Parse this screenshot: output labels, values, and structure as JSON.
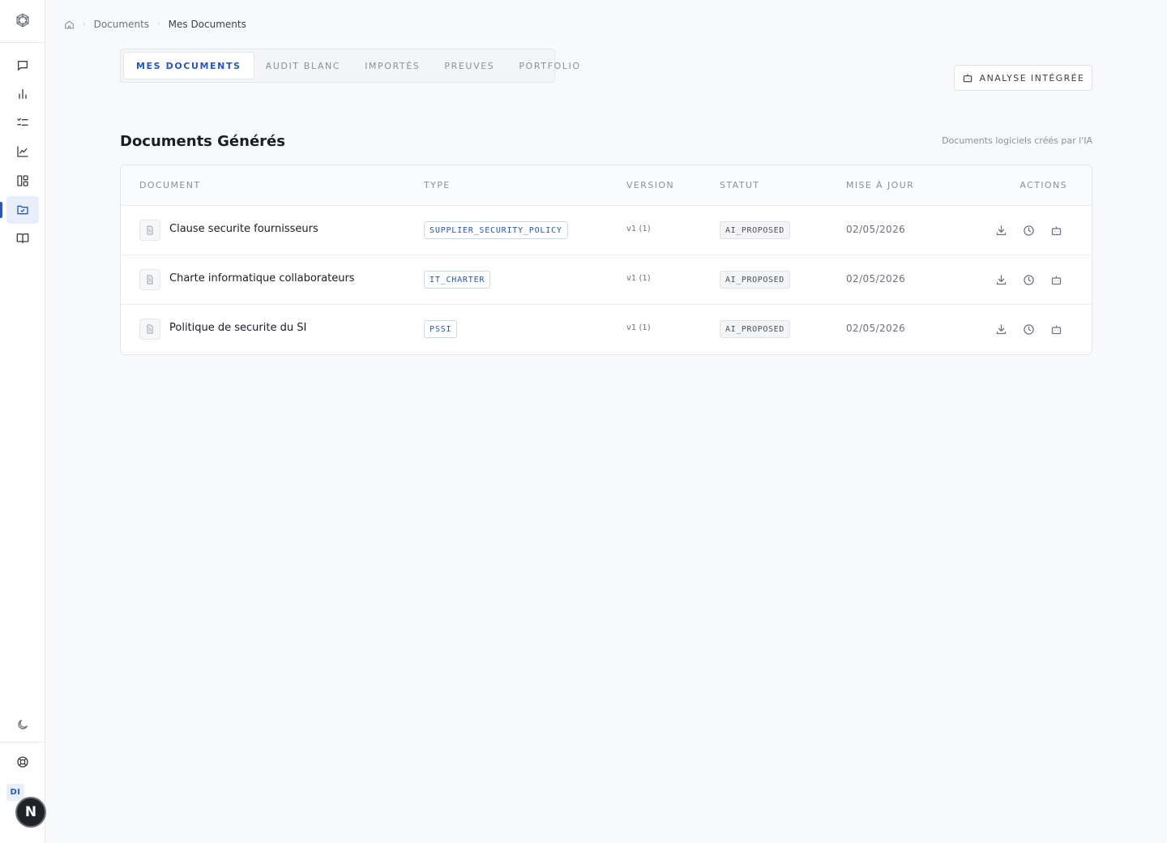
{
  "breadcrumb": {
    "items": [
      "Documents",
      "Mes Documents"
    ]
  },
  "tabs": [
    {
      "label": "MES DOCUMENTS",
      "active": true
    },
    {
      "label": "AUDIT BLANC",
      "active": false
    },
    {
      "label": "IMPORTÉS",
      "active": false
    },
    {
      "label": "PREUVES",
      "active": false
    },
    {
      "label": "PORTFOLIO",
      "active": false
    }
  ],
  "analyse_button": {
    "label": "ANALYSE INTÉGRÉE"
  },
  "section": {
    "title": "Documents Générés",
    "subtitle": "Documents logiciels créés par l'IA"
  },
  "table": {
    "headers": {
      "document": "DOCUMENT",
      "type": "TYPE",
      "version": "VERSION",
      "status": "STATUT",
      "updated": "MISE À JOUR",
      "actions": "ACTIONS"
    },
    "rows": [
      {
        "name": "Clause securite fournisseurs",
        "type": "SUPPLIER_SECURITY_POLICY",
        "version": "v1 (1)",
        "status": "AI_PROPOSED",
        "date": "02/05/2026"
      },
      {
        "name": "Charte informatique collaborateurs",
        "type": "IT_CHARTER",
        "version": "v1 (1)",
        "status": "AI_PROPOSED",
        "date": "02/05/2026"
      },
      {
        "name": "Politique de securite du SI",
        "type": "PSSI",
        "version": "v1 (1)",
        "status": "AI_PROPOSED",
        "date": "02/05/2026"
      }
    ]
  },
  "sidebar": {
    "items": [
      "chat-icon",
      "bar-chart-icon",
      "checklist-icon",
      "line-chart-icon",
      "dashboard-icon",
      "documents-icon",
      "book-icon"
    ],
    "active_item": "documents-icon",
    "user_initials": "DI",
    "fab_label": "N"
  },
  "colors": {
    "accent": "#2456c7",
    "background": "#f8f9fb"
  }
}
